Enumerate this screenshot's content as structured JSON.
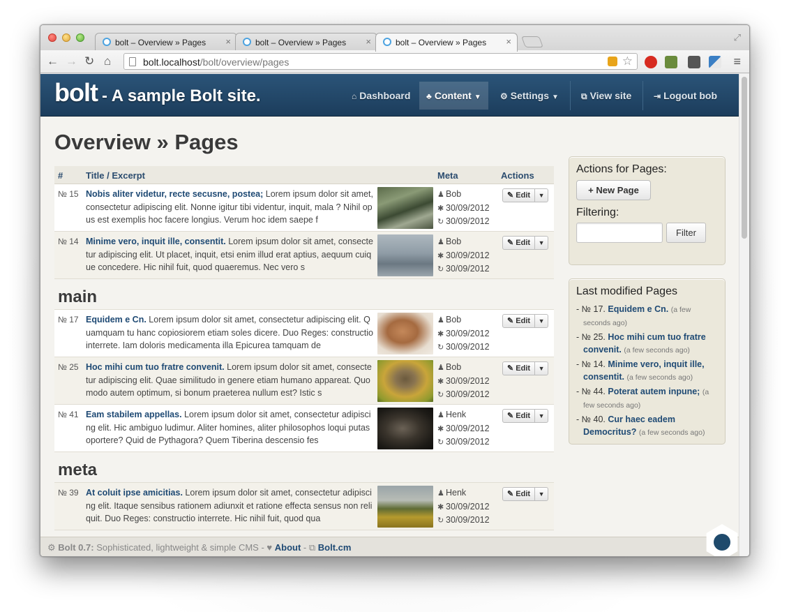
{
  "browser": {
    "tabs": [
      {
        "title": "bolt – Overview » Pages"
      },
      {
        "title": "bolt – Overview » Pages"
      },
      {
        "title": "bolt – Overview » Pages"
      }
    ],
    "url_host": "bolt.localhost",
    "url_path": "/bolt/overview/pages"
  },
  "site": {
    "logo": "bolt",
    "tagline": "- A sample Bolt site.",
    "nav": {
      "dashboard": "Dashboard",
      "content": "Content",
      "settings": "Settings",
      "view_site": "View site",
      "logout": "Logout bob"
    }
  },
  "page": {
    "title": "Overview » Pages",
    "columns": {
      "num": "#",
      "title": "Title / Excerpt",
      "meta": "Meta",
      "actions": "Actions"
    },
    "edit_label": "Edit",
    "groups": [
      {
        "heading": "",
        "rows": [
          {
            "num": "№ 15",
            "title": "Nobis aliter videtur, recte secusne, postea;",
            "excerpt": " Lorem ipsum dolor sit amet, consectetur adipiscing elit. Nonne igitur tibi videntur, inquit, mala ? Nihil opus est exemplis hoc facere longius. Verum hoc idem saepe f",
            "author": "Bob",
            "created": "30/09/2012",
            "modified": "30/09/2012"
          },
          {
            "num": "№ 14",
            "title": "Minime vero, inquit ille, consentit.",
            "excerpt": " Lorem ipsum dolor sit amet, consectetur adipiscing elit. Ut placet, inquit, etsi enim illud erat aptius, aequum cuique concedere. Hic nihil fuit, quod quaeremus. Nec vero s",
            "author": "Bob",
            "created": "30/09/2012",
            "modified": "30/09/2012"
          }
        ]
      },
      {
        "heading": "main",
        "rows": [
          {
            "num": "№ 17",
            "title": "Equidem e Cn.",
            "excerpt": " Lorem ipsum dolor sit amet, consectetur adipiscing elit. Quamquam tu hanc copiosiorem etiam soles dicere. Duo Reges: constructio interrete. Iam doloris medicamenta illa Epicurea tamquam de",
            "author": "Bob",
            "created": "30/09/2012",
            "modified": "30/09/2012"
          },
          {
            "num": "№ 25",
            "title": "Hoc mihi cum tuo fratre convenit.",
            "excerpt": " Lorem ipsum dolor sit amet, consectetur adipiscing elit. Quae similitudo in genere etiam humano appareat. Quo modo autem optimum, si bonum praeterea nullum est? Istic s",
            "author": "Bob",
            "created": "30/09/2012",
            "modified": "30/09/2012"
          },
          {
            "num": "№ 41",
            "title": "Eam stabilem appellas.",
            "excerpt": " Lorem ipsum dolor sit amet, consectetur adipiscing elit. Hic ambiguo ludimur. Aliter homines, aliter philosophos loqui putas oportere? Quid de Pythagora? Quem Tiberina descensio fes",
            "author": "Henk",
            "created": "30/09/2012",
            "modified": "30/09/2012"
          }
        ]
      },
      {
        "heading": "meta",
        "rows": [
          {
            "num": "№ 39",
            "title": "At coluit ipse amicitias.",
            "excerpt": " Lorem ipsum dolor sit amet, consectetur adipiscing elit. Itaque sensibus rationem adiunxit et ratione effecta sensus non reliquit. Duo Reges: constructio interrete. Hic nihil fuit, quod qua",
            "author": "Henk",
            "created": "30/09/2012",
            "modified": "30/09/2012"
          }
        ]
      }
    ]
  },
  "sidebar": {
    "actions_title": "Actions for Pages:",
    "new_page": "New Page",
    "filtering": "Filtering:",
    "filter_input_value": "",
    "filter_button": "Filter",
    "last_modified_title": "Last modified Pages",
    "last_modified": [
      {
        "num": "№ 17.",
        "title": "Equidem e Cn.",
        "ago": "(a few seconds ago)"
      },
      {
        "num": "№ 25.",
        "title": "Hoc mihi cum tuo fratre convenit.",
        "ago": "(a few seconds ago)"
      },
      {
        "num": "№ 14.",
        "title": "Minime vero, inquit ille, consentit.",
        "ago": "(a few seconds ago)"
      },
      {
        "num": "№ 44.",
        "title": "Poterat autem inpune;",
        "ago": "(a few seconds ago)"
      },
      {
        "num": "№ 40.",
        "title": "Cur haec eadem Democritus?",
        "ago": "(a few seconds ago)"
      }
    ]
  },
  "footer": {
    "version": "Bolt 0.7:",
    "tagline": " Sophisticated, lightweight & simple CMS - ",
    "about": "About",
    "sep": " - ",
    "boltcm": "Bolt.cm"
  },
  "colors": {
    "header_blue": "#1f4468",
    "link_blue": "#1f4a74",
    "panel_bg": "#ebe8db"
  },
  "icons": [
    "home-icon",
    "sitemap-icon",
    "cogs-icon",
    "external-link-icon",
    "sign-out-icon",
    "user-icon",
    "asterisk-icon",
    "refresh-icon",
    "edit-icon",
    "plus-icon",
    "heart-icon"
  ]
}
